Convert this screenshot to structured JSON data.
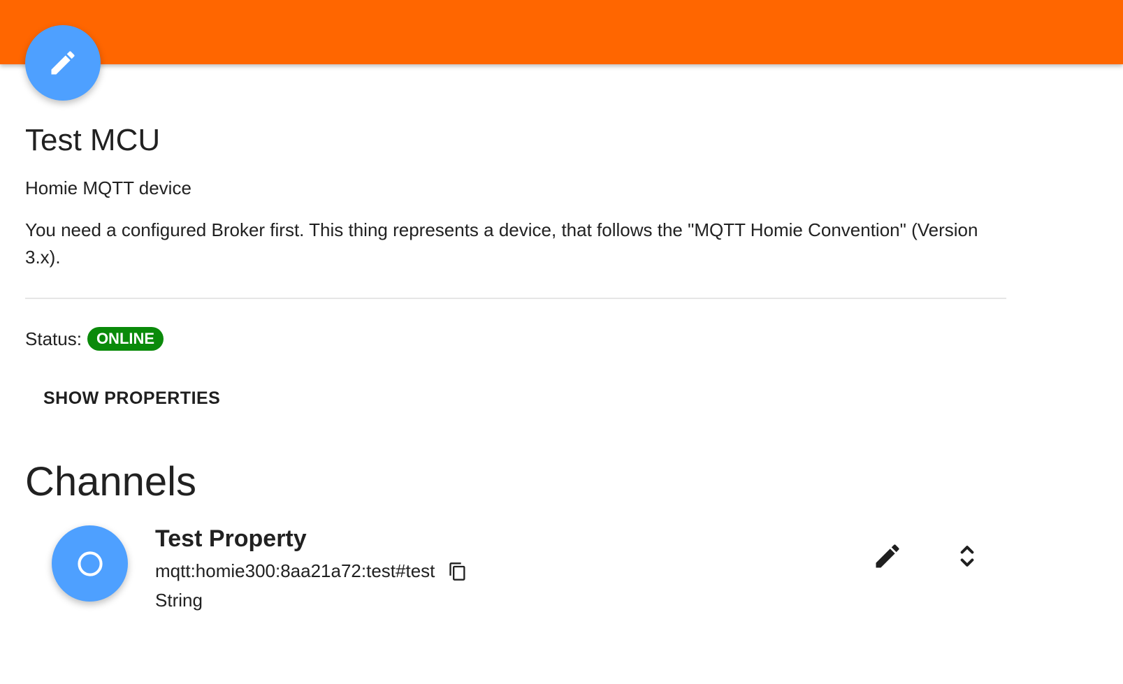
{
  "colors": {
    "header": "#ff6600",
    "fab": "#4ea0ff",
    "status_online": "#0a8a0a"
  },
  "thing": {
    "title": "Test MCU",
    "subtitle": "Homie MQTT device",
    "description": "You need a configured Broker first. This thing represents a device, that follows the \"MQTT Homie Convention\" (Version 3.x).",
    "status_label": "Status:",
    "status_value": "ONLINE",
    "show_properties_label": "SHOW PROPERTIES",
    "edit_icon": "pencil-icon"
  },
  "channels": {
    "heading": "Channels",
    "items": [
      {
        "label": "Test Property",
        "uid": "mqtt:homie300:8aa21a72:test#test",
        "type": "String",
        "icon": "circle-outline-icon",
        "copy_icon": "copy-icon",
        "edit_icon": "pencil-icon",
        "expand_icon": "unfold-more-icon"
      }
    ]
  }
}
